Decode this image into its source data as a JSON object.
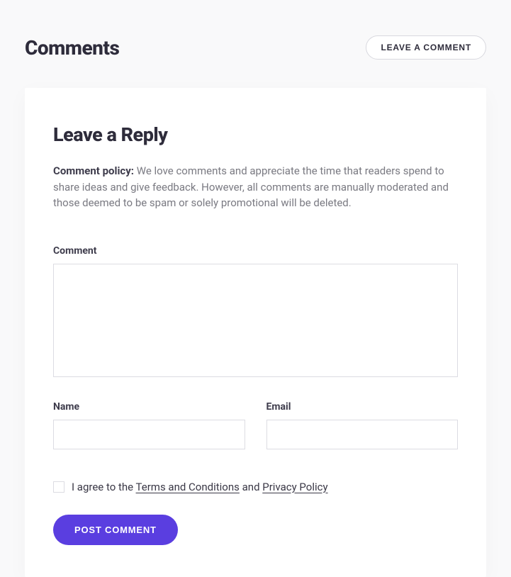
{
  "header": {
    "title": "Comments",
    "leave_button": "LEAVE A COMMENT"
  },
  "form": {
    "title": "Leave a Reply",
    "policy_label": "Comment policy:",
    "policy_text": " We love comments and appreciate the time that readers spend to share ideas and give feedback. However, all comments are manually moderated and those deemed to be spam or solely promotional will be deleted.",
    "comment_label": "Comment",
    "comment_value": "",
    "name_label": "Name",
    "name_value": "",
    "email_label": "Email",
    "email_value": "",
    "consent_prefix": "I agree to the ",
    "consent_terms": "Terms and Conditions",
    "consent_and": " and ",
    "consent_privacy": "Privacy Policy",
    "submit_label": "POST COMMENT"
  },
  "colors": {
    "accent": "#5a3ee0"
  }
}
